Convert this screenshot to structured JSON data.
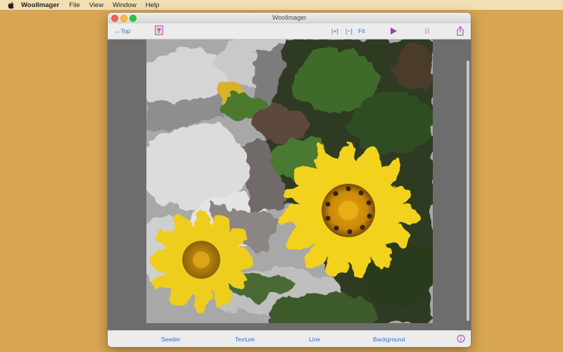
{
  "menubar": {
    "app_name": "WoolImager",
    "menus": [
      "File",
      "View",
      "Window",
      "Help"
    ]
  },
  "window": {
    "title": "WoolImager"
  },
  "toolbar": {
    "top_label": "←Top",
    "zoom_in_label": "[+]",
    "zoom_out_label": "[−]",
    "fit_label": "Fit",
    "icons": [
      "image-thumbnail-icon",
      "play-icon",
      "pause-icon",
      "share-icon"
    ],
    "accent_color": "#2f6fe0",
    "play_color": "#a13bb0"
  },
  "canvas": {
    "subject": "painted-sunflowers-image"
  },
  "tabs": {
    "seeder": "Seeder",
    "texture": "Texture",
    "line": "Line",
    "background": "Background",
    "info_icon": "info-icon"
  },
  "colors": {
    "desktop": "#d8a652",
    "menubar": "#f2dfb2",
    "window_bg": "#6d6d6d"
  }
}
